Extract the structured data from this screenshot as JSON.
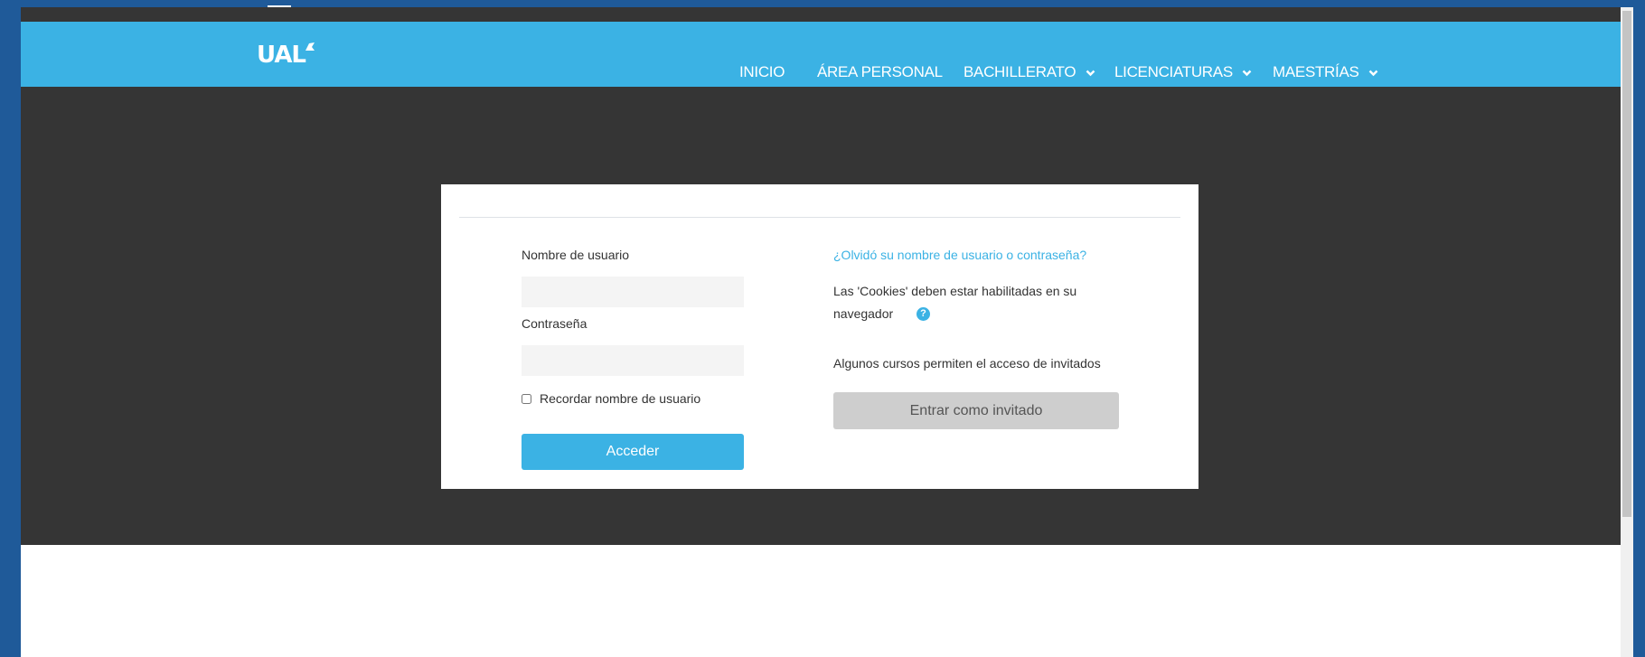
{
  "brand": {
    "logo_text": "UAL"
  },
  "nav": {
    "items": [
      {
        "label": "INICIO"
      },
      {
        "label": "ÁREA PERSONAL"
      },
      {
        "label": "BACHILLERATO"
      },
      {
        "label": "LICENCIATURAS"
      },
      {
        "label": "MAESTRÍAS"
      }
    ]
  },
  "login": {
    "username_label": "Nombre de usuario",
    "username_value": "",
    "password_label": "Contraseña",
    "password_value": "",
    "remember_label": "Recordar nombre de usuario",
    "remember_checked": false,
    "submit_label": "Acceder",
    "forgot_link": "¿Olvidó su nombre de usuario o contraseña?",
    "cookies_line1": "Las 'Cookies' deben estar habilitadas en su",
    "cookies_line2": "navegador",
    "guest_text": "Algunos cursos permiten el acceso de invitados",
    "guest_button": "Entrar como invitado"
  },
  "colors": {
    "accent": "#3bb2e4",
    "dark": "#353535",
    "desktop": "#1f5a99"
  },
  "icons": {
    "help": "question-circle-icon",
    "chevron": "chevron-down-icon"
  }
}
